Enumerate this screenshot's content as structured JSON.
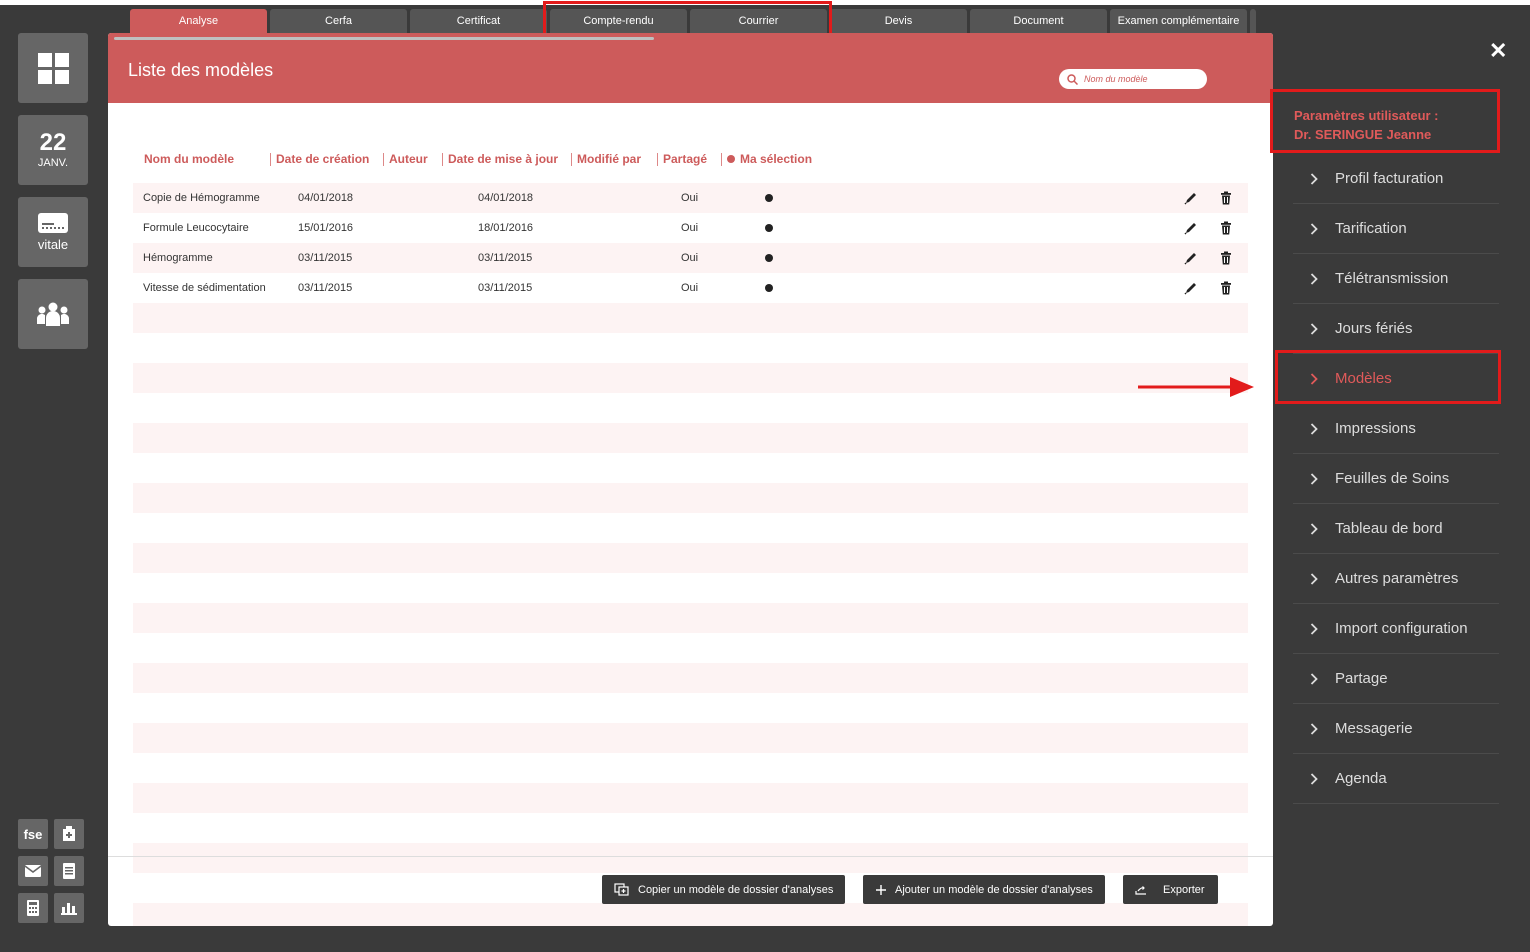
{
  "tabs": [
    {
      "label": "Analyse",
      "active": true
    },
    {
      "label": "Cerfa",
      "active": false
    },
    {
      "label": "Certificat",
      "active": false
    },
    {
      "label": "Compte-rendu",
      "active": false
    },
    {
      "label": "Courrier",
      "active": false
    },
    {
      "label": "Devis",
      "active": false
    },
    {
      "label": "Document",
      "active": false
    },
    {
      "label": "Examen complémentaire",
      "active": false
    }
  ],
  "sidebar": {
    "date_day": "22",
    "date_month": "JANV.",
    "vitale_label": "vitale",
    "fse_label": "fse"
  },
  "panel": {
    "title": "Liste des modèles",
    "search_placeholder": "Nom du modèle"
  },
  "columns": [
    "Nom du modèle",
    "Date de création",
    "Auteur",
    "Date de mise à jour",
    "Modifié par",
    "Partagé",
    "Ma sélection"
  ],
  "rows": [
    {
      "name": "Copie de Hémogramme",
      "created": "04/01/2018",
      "author": "",
      "updated": "04/01/2018",
      "modified_by": "",
      "shared": "Oui",
      "selected": true
    },
    {
      "name": "Formule Leucocytaire",
      "created": "15/01/2016",
      "author": "",
      "updated": "18/01/2016",
      "modified_by": "",
      "shared": "Oui",
      "selected": true
    },
    {
      "name": "Hémogramme",
      "created": "03/11/2015",
      "author": "",
      "updated": "03/11/2015",
      "modified_by": "",
      "shared": "Oui",
      "selected": true
    },
    {
      "name": "Vitesse de sédimentation",
      "created": "03/11/2015",
      "author": "",
      "updated": "03/11/2015",
      "modified_by": "",
      "shared": "Oui",
      "selected": true
    }
  ],
  "buttons": {
    "copy": "Copier un modèle de dossier d'analyses",
    "add": "Ajouter un modèle de dossier d'analyses",
    "export": "Exporter"
  },
  "user": {
    "line1": "Paramètres utilisateur :",
    "line2": "Dr. SERINGUE Jeanne"
  },
  "menu": [
    {
      "label": "Profil facturation",
      "active": false
    },
    {
      "label": "Tarification",
      "active": false
    },
    {
      "label": "Télétransmission",
      "active": false
    },
    {
      "label": "Jours fériés",
      "active": false
    },
    {
      "label": "Modèles",
      "active": true
    },
    {
      "label": "Impressions",
      "active": false
    },
    {
      "label": "Feuilles de Soins",
      "active": false
    },
    {
      "label": "Tableau de bord",
      "active": false
    },
    {
      "label": "Autres paramètres",
      "active": false
    },
    {
      "label": "Import configuration",
      "active": false
    },
    {
      "label": "Partage",
      "active": false
    },
    {
      "label": "Messagerie",
      "active": false
    },
    {
      "label": "Agenda",
      "active": false
    }
  ],
  "colors": {
    "accent": "#cd5b5b",
    "highlight": "#e21b1b",
    "background": "#3a3a3a"
  }
}
